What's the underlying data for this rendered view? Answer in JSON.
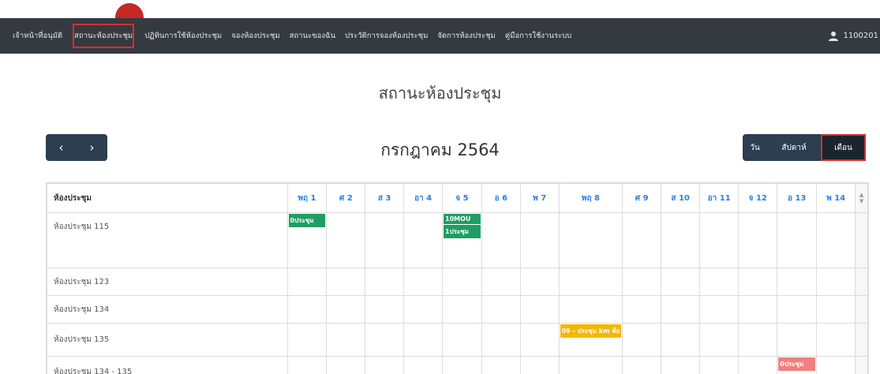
{
  "nav": {
    "items": [
      {
        "label": "เจ้าหน้าที่อนุมัติ"
      },
      {
        "label": "สถานะห้องประชุม"
      },
      {
        "label": "ปฏิทินการใช้ห้องประชุม"
      },
      {
        "label": "จองห้องประชุม"
      },
      {
        "label": "สถานะของฉัน"
      },
      {
        "label": "ประวัติการจองห้องประชุม"
      },
      {
        "label": "จัดการห้องประชุม"
      },
      {
        "label": "คู่มือการใช้งานระบบ"
      }
    ],
    "user": "1100201"
  },
  "page_title": "สถานะห้องประชุม",
  "calendar": {
    "prev_label": "‹",
    "next_label": "›",
    "month_title": "กรกฎาคม 2564",
    "views": {
      "day": "วัน",
      "week": "สัปดาห์",
      "month": "เดือน"
    },
    "room_header": "ห้องประชุม",
    "days": [
      "พฤ 1",
      "ศ 2",
      "ส 3",
      "อา 4",
      "จ 5",
      "อ 6",
      "พ 7",
      "พฤ 8",
      "ศ 9",
      "ส 10",
      "อา 11",
      "จ 12",
      "อ 13",
      "พ 14"
    ],
    "rooms": [
      {
        "name": "ห้องประชุม 115"
      },
      {
        "name": "ห้องประชุม 123"
      },
      {
        "name": "ห้องประชุม 134"
      },
      {
        "name": "ห้องประชุม 135"
      },
      {
        "name": "ห้องประชุม 134 - 135"
      }
    ],
    "events": [
      {
        "room": 0,
        "day": 0,
        "label": "0ประชุม",
        "color": "#1e9e63"
      },
      {
        "room": 0,
        "day": 4,
        "label": "10MOU",
        "color": "#1e9e63"
      },
      {
        "room": 0,
        "day": 4,
        "label": "1ประชุม",
        "color": "#1e9e63"
      },
      {
        "room": 3,
        "day": 7,
        "label": "09 - ประชุม km ห้อ",
        "color": "#f5b800"
      },
      {
        "room": 4,
        "day": 12,
        "label": "0ประชุม",
        "color": "#f08080"
      }
    ]
  },
  "colors": {
    "navbar": "#343a40",
    "highlight": "#d32f2f",
    "day_header": "#2a7fe0"
  }
}
